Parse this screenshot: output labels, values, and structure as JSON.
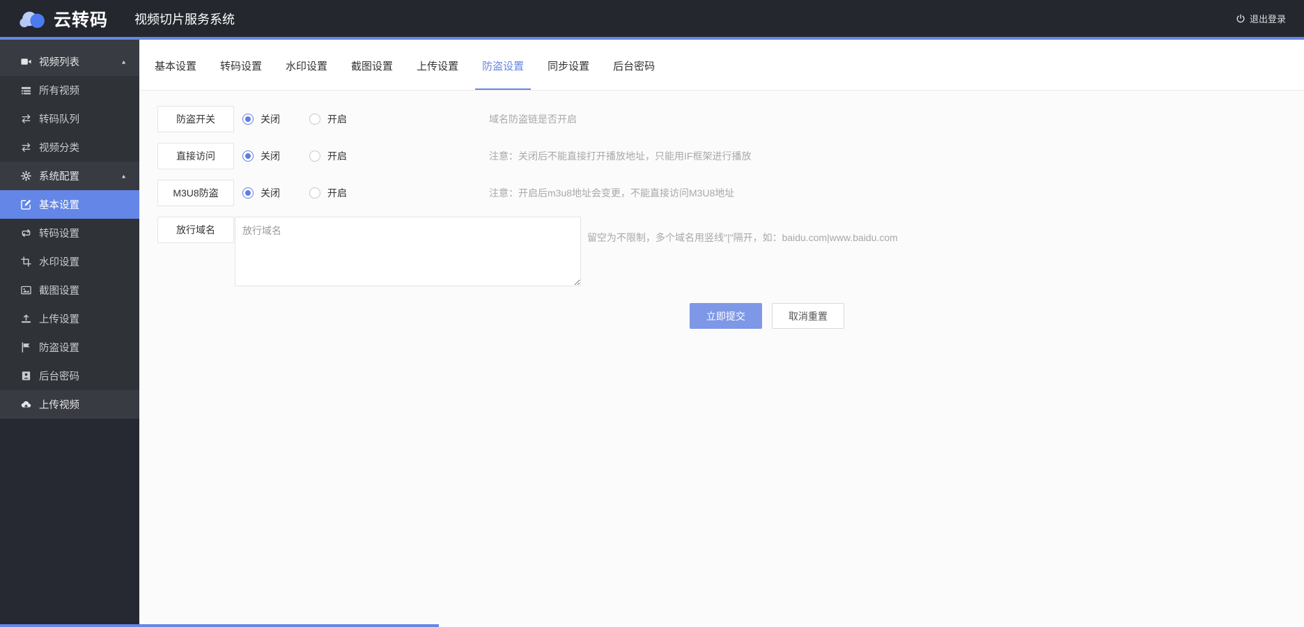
{
  "colors": {
    "accent": "#6486e6",
    "button_blue": "#7e97e6",
    "header_bg": "#24272e",
    "sidebar_bg": "#383b41",
    "sidebar_sub_bg": "#2f3237",
    "active_item_bg": "#6486e6"
  },
  "header": {
    "logo_icon": "cloud-logo-icon",
    "logo_text": "云转码",
    "title": "视频切片服务系统",
    "logout_icon": "power-icon",
    "logout_label": "退出登录"
  },
  "sidebar": {
    "items": [
      {
        "label": "视频列表",
        "icon": "video-camera-icon",
        "type": "group",
        "arrow": "▲"
      },
      {
        "label": "所有视频",
        "icon": "list-icon",
        "type": "sub"
      },
      {
        "label": "转码队列",
        "icon": "exchange-icon",
        "type": "sub"
      },
      {
        "label": "视频分类",
        "icon": "exchange-icon",
        "type": "sub"
      },
      {
        "label": "系统配置",
        "icon": "gear-icon",
        "type": "group",
        "arrow": "▲"
      },
      {
        "label": "基本设置",
        "icon": "edit-icon",
        "type": "sub",
        "active": true
      },
      {
        "label": "转码设置",
        "icon": "retweet-icon",
        "type": "sub"
      },
      {
        "label": "水印设置",
        "icon": "crop-icon",
        "type": "sub"
      },
      {
        "label": "截图设置",
        "icon": "image-icon",
        "type": "sub"
      },
      {
        "label": "上传设置",
        "icon": "upload-icon",
        "type": "sub"
      },
      {
        "label": "防盗设置",
        "icon": "flag-icon",
        "type": "sub"
      },
      {
        "label": "后台密码",
        "icon": "idcard-icon",
        "type": "sub"
      },
      {
        "label": "上传视频",
        "icon": "cloud-upload-icon",
        "type": "item"
      }
    ]
  },
  "tabs": {
    "active": "防盗设置",
    "active_index": 5,
    "items": [
      "基本设置",
      "转码设置",
      "水印设置",
      "截图设置",
      "上传设置",
      "防盗设置",
      "同步设置",
      "后台密码"
    ]
  },
  "form": {
    "rows": [
      {
        "label": "防盗开关",
        "options": [
          "关闭",
          "开启"
        ],
        "selected": "关闭",
        "hint": "域名防盗链是否开启"
      },
      {
        "label": "直接访问",
        "options": [
          "关闭",
          "开启"
        ],
        "selected": "关闭",
        "hint": "注意：关闭后不能直接打开播放地址，只能用IF框架进行播放"
      },
      {
        "label": "M3U8防盗",
        "options": [
          "关闭",
          "开启"
        ],
        "selected": "关闭",
        "hint": "注意：开启后m3u8地址会变更，不能直接访问M3U8地址"
      }
    ],
    "domain_row": {
      "label": "放行域名",
      "placeholder": "放行域名",
      "value": "",
      "hint": "留空为不限制，多个域名用竖线\"|\"隔开，如：baidu.com|www.baidu.com"
    },
    "submit_label": "立即提交",
    "reset_label": "取消重置"
  }
}
